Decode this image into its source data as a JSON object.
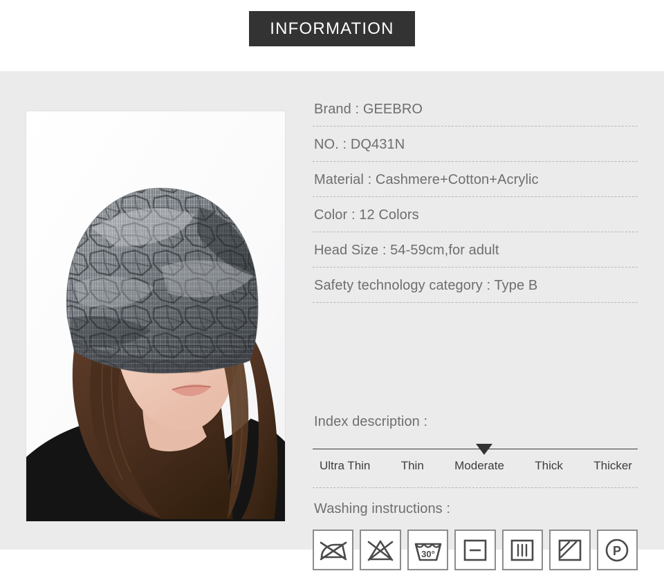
{
  "header": {
    "banner_label": "INFORMATION"
  },
  "photo": {
    "alt": "model-wearing-gray-patterned-beanie"
  },
  "specs": [
    "Brand : GEEBRO",
    "NO. : DQ431N",
    "Material : Cashmere+Cotton+Acrylic",
    "Color : 12 Colors",
    "Head Size : 54-59cm,for adult",
    "Safety technology category : Type B"
  ],
  "index": {
    "title": "Index description :",
    "labels": [
      "Ultra Thin",
      "Thin",
      "Moderate",
      "Thick",
      "Thicker"
    ],
    "selected": "Moderate"
  },
  "washing": {
    "title": "Washing instructions :",
    "icons": [
      "do-not-iron-icon",
      "do-not-bleach-icon",
      "machine-wash-30-icon",
      "dry-flat-icon",
      "drip-dry-icon",
      "dry-in-shade-icon",
      "dry-clean-p-icon"
    ],
    "wash_temperature": "30°"
  },
  "colors": {
    "banner_bg": "#333333",
    "panel_bg": "#ebebeb",
    "text": "#6e6e6e",
    "scale_text": "#3d3d3d",
    "icon_stroke": "#8c8c8c"
  }
}
